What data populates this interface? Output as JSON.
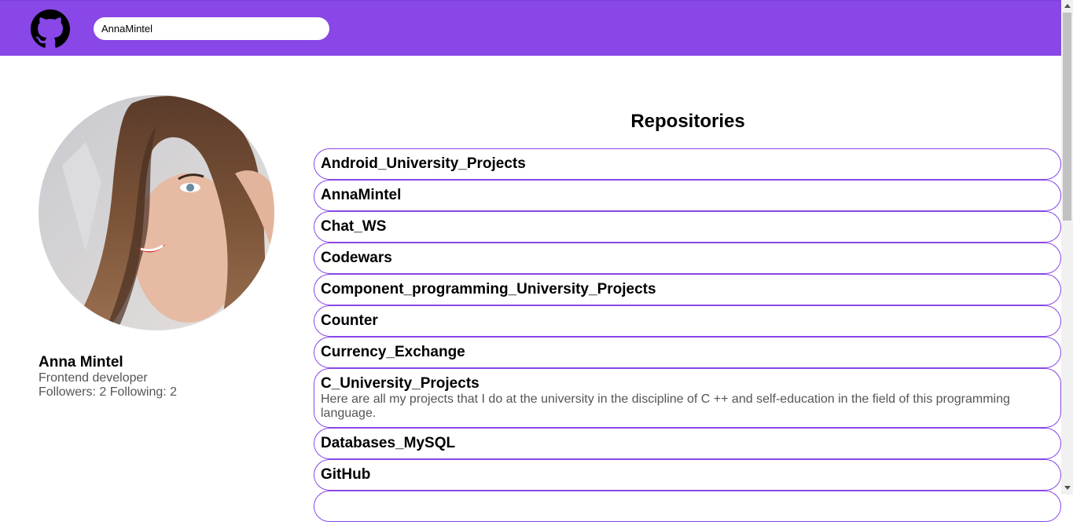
{
  "header": {
    "logo_icon": "github-octocat-icon",
    "search_value": "AnnaMintel",
    "bg_color": "#8847e6"
  },
  "profile": {
    "name": "Anna Mintel",
    "bio": "Frontend developer",
    "stats": "Followers: 2 Following: 2"
  },
  "repositories": {
    "title": "Repositories",
    "items": [
      {
        "name": "Android_University_Projects",
        "description": ""
      },
      {
        "name": "AnnaMintel",
        "description": ""
      },
      {
        "name": "Chat_WS",
        "description": ""
      },
      {
        "name": "Codewars",
        "description": ""
      },
      {
        "name": "Component_programming_University_Projects",
        "description": ""
      },
      {
        "name": "Counter",
        "description": ""
      },
      {
        "name": "Currency_Exchange",
        "description": ""
      },
      {
        "name": "C_University_Projects",
        "description": "Here are all my projects that I do at the university in the discipline of C ++ and self-education in the field of this programming language."
      },
      {
        "name": "Databases_MySQL",
        "description": ""
      },
      {
        "name": "GitHub",
        "description": ""
      },
      {
        "name": "",
        "description": ""
      }
    ]
  },
  "accent_color": "#8847e6"
}
